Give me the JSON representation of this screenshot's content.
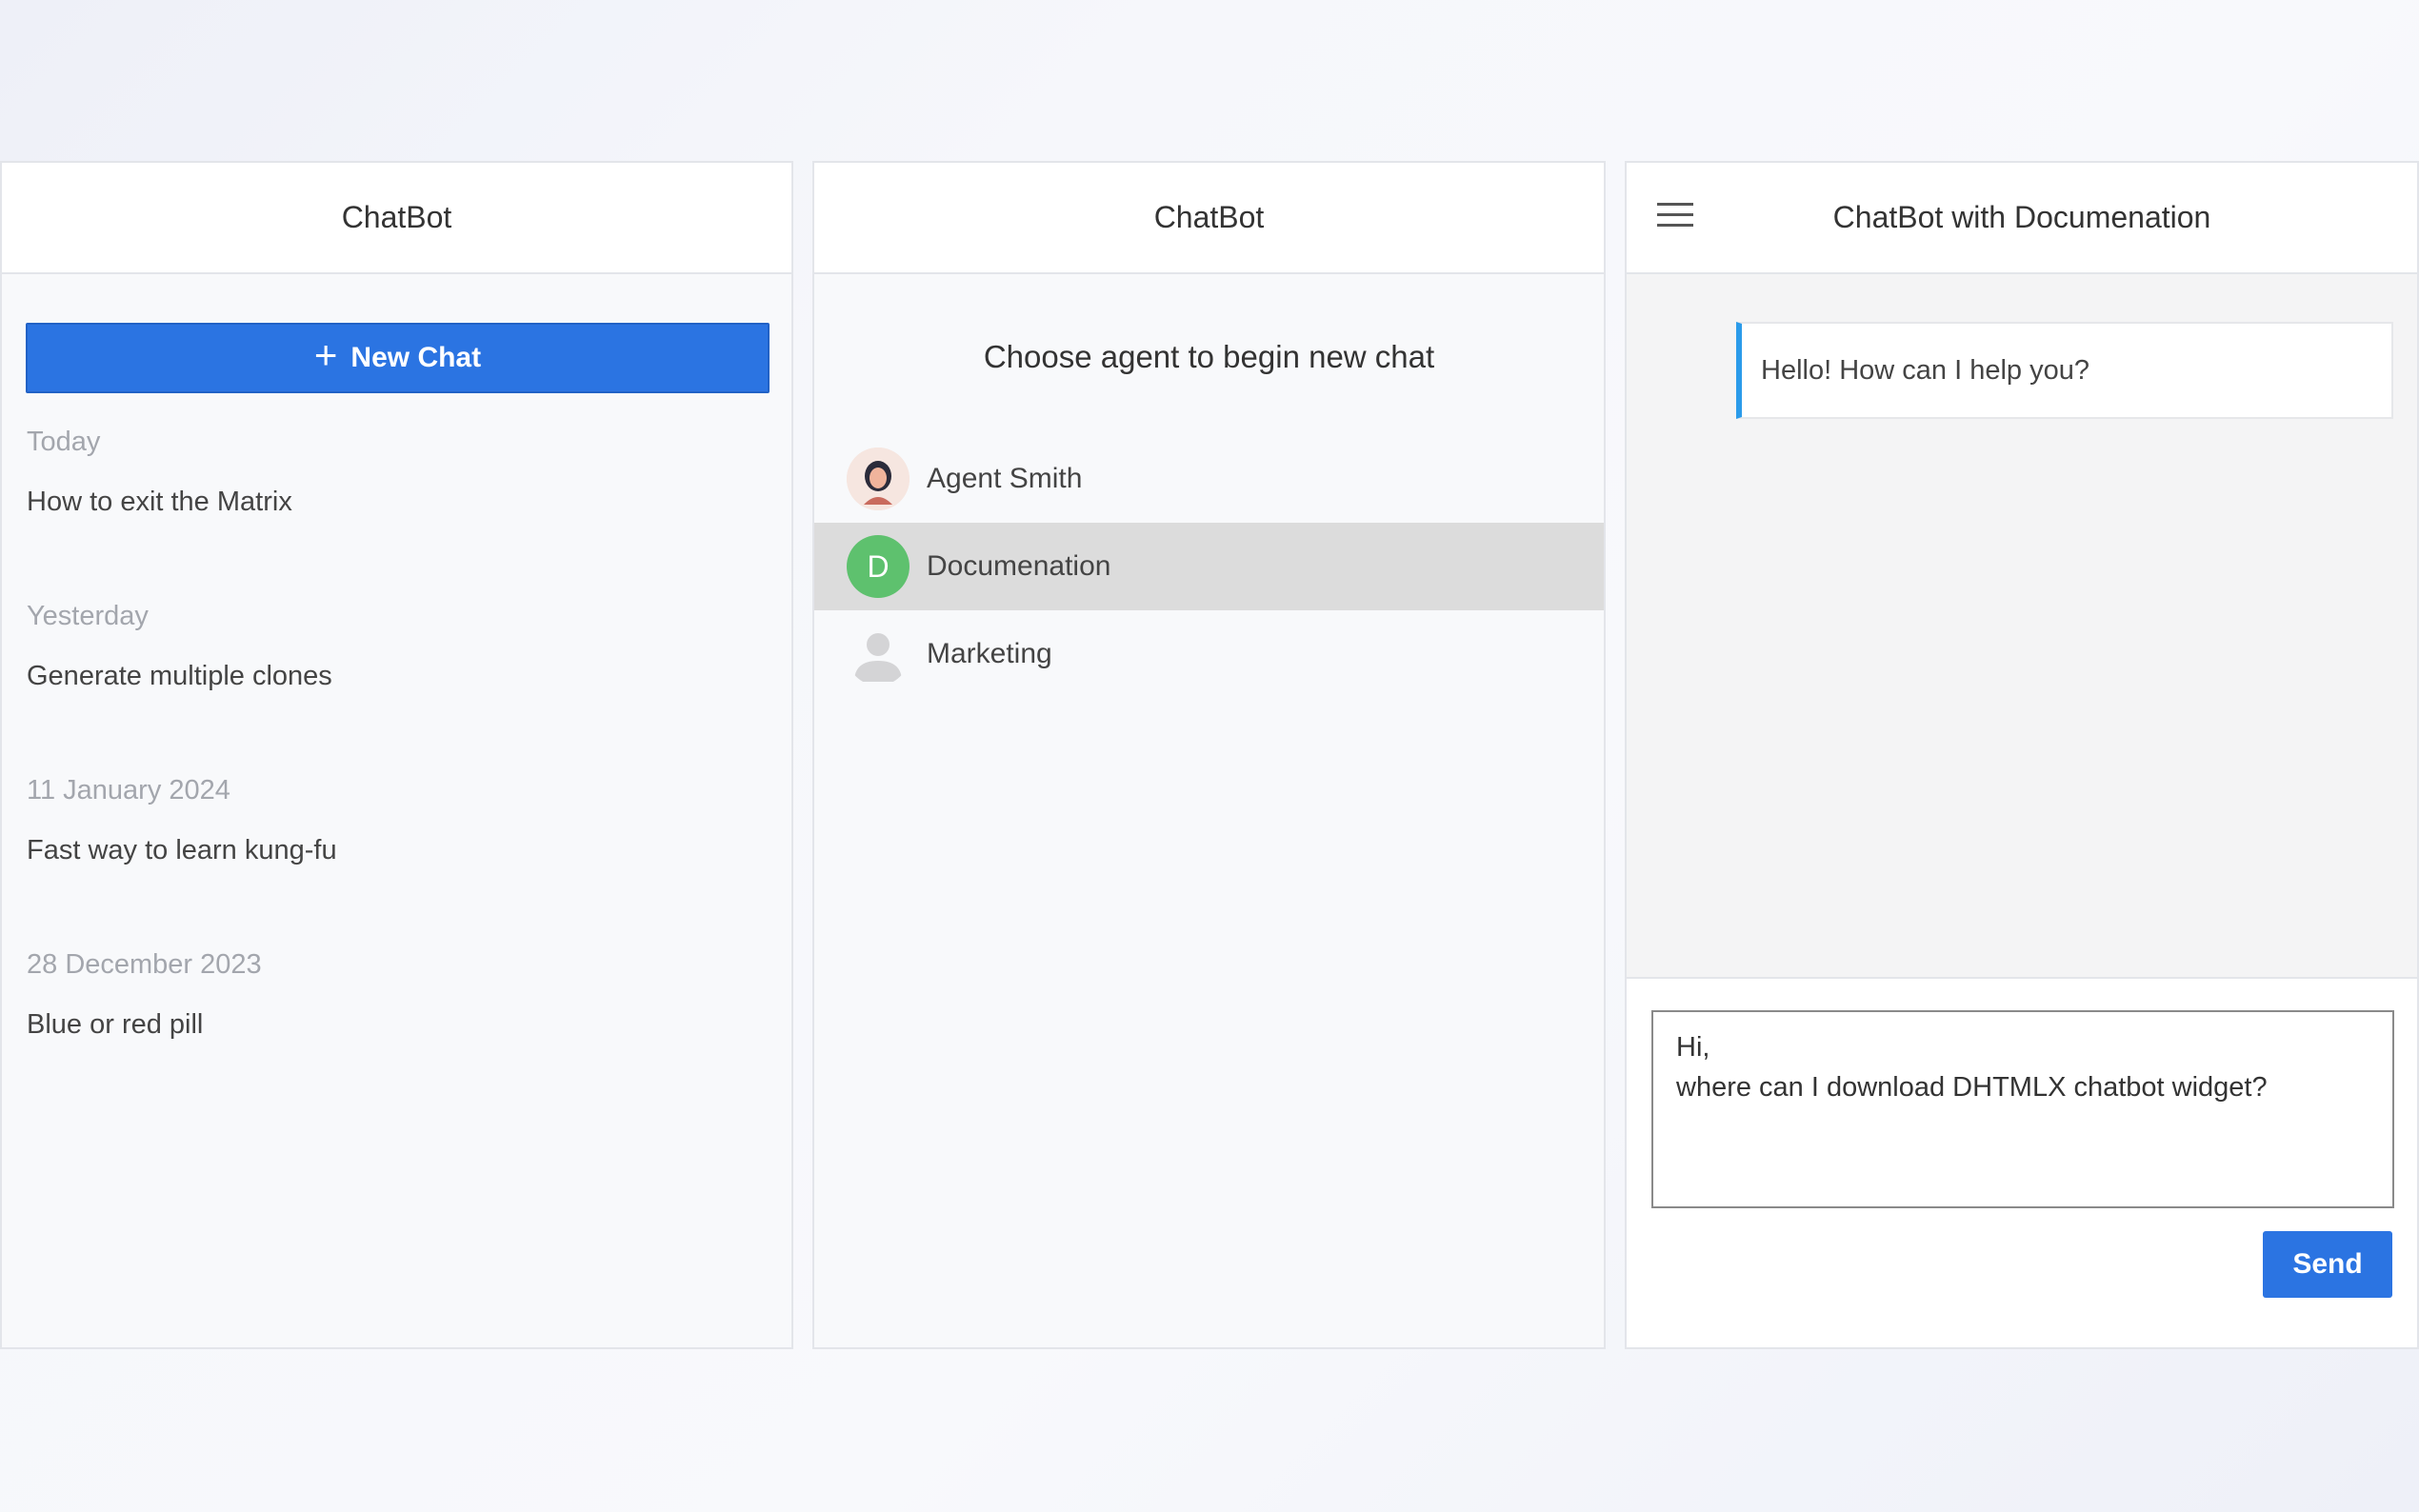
{
  "history_panel": {
    "title": "ChatBot",
    "new_chat_label": "New Chat",
    "groups": [
      {
        "date": "Today",
        "item": "How to exit the Matrix"
      },
      {
        "date": "Yesterday",
        "item": "Generate multiple clones"
      },
      {
        "date": "11 January 2024",
        "item": "Fast way to learn kung-fu"
      },
      {
        "date": "28 December 2023",
        "item": "Blue or red pill"
      }
    ]
  },
  "agents_panel": {
    "title": "ChatBot",
    "prompt": "Choose agent to begin new chat",
    "agents": [
      {
        "name": "Agent Smith",
        "avatar": "photo-avatar"
      },
      {
        "name": "Documenation",
        "avatar_initial": "D",
        "selected": true
      },
      {
        "name": "Marketing",
        "avatar": "default-user-avatar"
      }
    ]
  },
  "chat_panel": {
    "title": "ChatBot with Documenation",
    "bot_message": "Hello! How can I help you?",
    "input_value": "Hi,\nwhere can I download DHTMLX chatbot widget?",
    "send_label": "Send"
  },
  "colors": {
    "primary": "#2b74e2",
    "selected_row": "#dcdcdc",
    "avatar_green": "#5ec16e",
    "message_accent": "#2b9bea"
  }
}
